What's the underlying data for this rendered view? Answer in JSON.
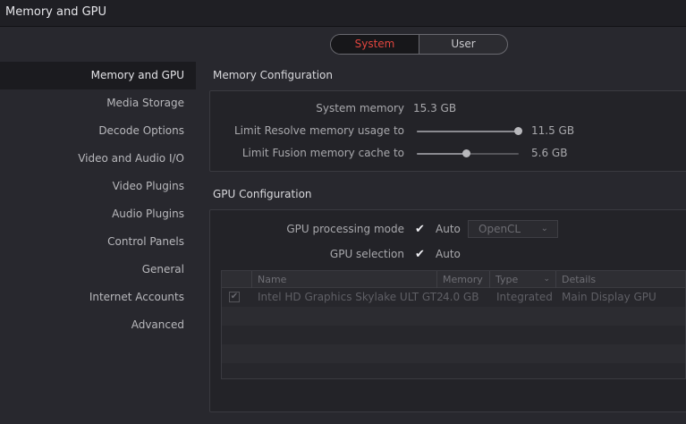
{
  "window": {
    "title": "Memory and GPU"
  },
  "tabs": [
    {
      "label": "System",
      "active": true
    },
    {
      "label": "User",
      "active": false
    }
  ],
  "sidebar": {
    "items": [
      {
        "label": "Memory and GPU",
        "active": true
      },
      {
        "label": "Media Storage"
      },
      {
        "label": "Decode Options"
      },
      {
        "label": "Video and Audio I/O"
      },
      {
        "label": "Video Plugins"
      },
      {
        "label": "Audio Plugins"
      },
      {
        "label": "Control Panels"
      },
      {
        "label": "General"
      },
      {
        "label": "Internet Accounts"
      },
      {
        "label": "Advanced"
      }
    ]
  },
  "memory": {
    "section_title": "Memory Configuration",
    "system_memory_label": "System memory",
    "system_memory_value": "15.3 GB",
    "resolve_limit_label": "Limit Resolve memory usage to",
    "resolve_limit_value": "11.5 GB",
    "resolve_limit_fraction": 0.99,
    "fusion_cache_label": "Limit Fusion memory cache to",
    "fusion_cache_value": "5.6 GB",
    "fusion_cache_fraction": 0.48
  },
  "gpu": {
    "section_title": "GPU Configuration",
    "processing_mode_label": "GPU processing mode",
    "processing_mode_auto_label": "Auto",
    "processing_mode_auto_checked": true,
    "processing_mode_select": "OpenCL",
    "selection_label": "GPU selection",
    "selection_auto_label": "Auto",
    "selection_auto_checked": true,
    "table": {
      "columns": [
        "Name",
        "Memory",
        "Type",
        "Details"
      ],
      "rows": [
        {
          "checked": true,
          "name": "Intel HD Graphics Skylake ULT GT2",
          "memory": "4.0 GB",
          "type": "Integrated",
          "details": "Main Display GPU"
        }
      ]
    }
  },
  "colors": {
    "accent": "#e0453e",
    "background": "#28282e",
    "panel": "#232328"
  }
}
